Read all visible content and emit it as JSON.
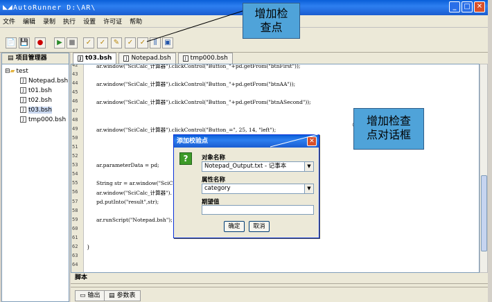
{
  "window": {
    "title": "AutoRunner  D:\\AR\\",
    "minimize": "_",
    "maximize": "□",
    "close": "✕"
  },
  "menu": [
    "文件",
    "编辑",
    "录制",
    "执行",
    "设置",
    "许可证",
    "帮助"
  ],
  "left_panel": {
    "tab_label": "项目管理器",
    "root": "test",
    "files": [
      "Notepad.bsh",
      "t01.bsh",
      "t02.bsh",
      "t03.bsh",
      "tmp000.bsh"
    ],
    "selected": "t03.bsh"
  },
  "editor_tabs": [
    "t03.bsh",
    "Notepad.bsh",
    "tmp000.bsh"
  ],
  "active_tab": "t03.bsh",
  "line_numbers": [
    "42",
    "43",
    "44",
    "45",
    "46",
    "47",
    "48",
    "49",
    "50",
    "51",
    "52",
    "53",
    "54",
    "55",
    "56",
    "57",
    "58",
    "59",
    "60",
    "61",
    "62",
    "63",
    "64"
  ],
  "code_lines": [
    {
      "line": "42",
      "text": "ar.window(\"SciCalc_计算器\").clickControl(\"Button_\"+pd.getFrom(\"btnFirst\"));"
    },
    {
      "line": "44",
      "text": "ar.window(\"SciCalc_计算器\").clickControl(\"Button_\"+pd.getFrom(\"btnAA\"));"
    },
    {
      "line": "46",
      "text": "ar.window(\"SciCalc_计算器\").clickControl(\"Button_\"+pd.getFrom(\"btnASecond\"));"
    },
    {
      "line": "49",
      "text": "ar.window(\"SciCalc_计算器\").clickControl(\"Button_=\", 25, 14, \"left\");"
    },
    {
      "line": "53",
      "text": "ar.parameterData = pd;"
    },
    {
      "line": "55",
      "text": "String str = ar.window(\"SciC"
    },
    {
      "line": "56",
      "text": "ar.window(\"SciCalc_计算器\")."
    },
    {
      "line": "57",
      "text": "pd.putInto(\"result\",str);"
    },
    {
      "line": "59",
      "text": "ar.runScript(\"Notepad.bsh\");"
    },
    {
      "line": "62",
      "text": "}"
    }
  ],
  "script_bar_label": "脚本",
  "bottom_tabs": [
    "输出",
    "参数表"
  ],
  "dialog": {
    "title": "添加校验点",
    "object_label": "对象名称",
    "object_value": "Notepad_Output.txt - 记事本",
    "property_label": "属性名称",
    "property_value": "category",
    "expected_label": "期望值",
    "expected_value": "",
    "ok": "确定",
    "cancel": "取消"
  },
  "callouts": {
    "add_checkpoint": "增加检\n查点",
    "add_checkpoint_dialog": "增加检查\n点对话框"
  },
  "colors": {
    "titlebar": "#0a5fd8",
    "callout": "#4fa3d9"
  }
}
